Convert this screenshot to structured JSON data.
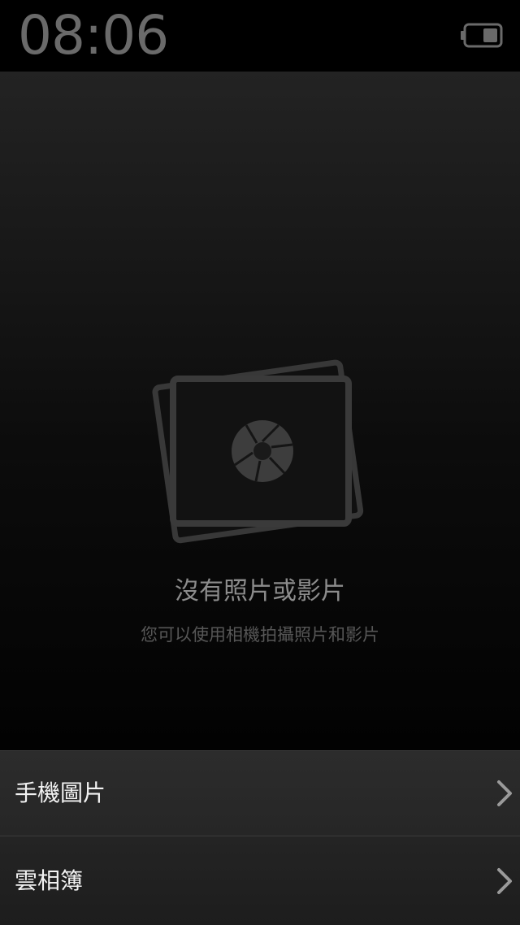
{
  "status_bar": {
    "time": "08:06",
    "battery_icon": "battery-icon"
  },
  "empty_state": {
    "icon": "photo-stack-icon",
    "title": "沒有照片或影片",
    "subtitle": "您可以使用相機拍攝照片和影片"
  },
  "menu": {
    "items": [
      {
        "label": "手機圖片",
        "icon": "chevron-right-icon"
      },
      {
        "label": "雲相簿",
        "icon": "chevron-right-icon"
      }
    ]
  },
  "colors": {
    "background": "#000000",
    "clock_text": "#6a6a6a",
    "title_text": "#8c8c8c",
    "subtitle_text": "#575757",
    "menu_text": "#f2f2f2",
    "icon_gray": "#3a3a3a"
  }
}
